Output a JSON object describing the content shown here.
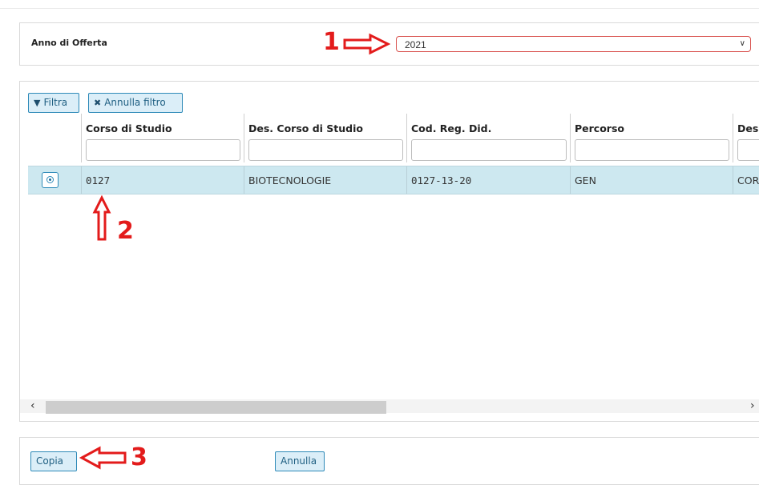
{
  "offer_year": {
    "label": "Anno di Offerta",
    "selected": "2021"
  },
  "toolbar": {
    "filter_label": "Filtra",
    "clear_filter_label": "Annulla filtro"
  },
  "table": {
    "columns": [
      "Corso di Studio",
      "Des. Corso di Studio",
      "Cod. Reg. Did.",
      "Percorso",
      "Des"
    ],
    "rows": [
      {
        "corso": "0127",
        "descrizione": "BIOTECNOLOGIE",
        "cod_reg_did": "0127-13-20",
        "percorso": "GEN",
        "des_percorso": "COR"
      }
    ]
  },
  "annotations": [
    "1",
    "2",
    "3"
  ],
  "annotation_color": "#e31b1b",
  "accent_color": "#2e8ab8",
  "selected_row_color": "#cde8f0",
  "footer": {
    "copy_label": "Copia",
    "cancel_label": "Annulla"
  }
}
